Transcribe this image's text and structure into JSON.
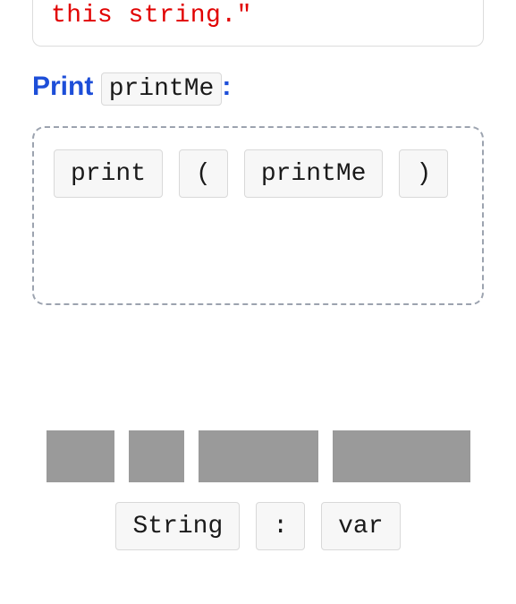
{
  "code_block": {
    "visible_string_fragment": "this string.\""
  },
  "instruction": {
    "keyword": "Print",
    "variable": "printMe",
    "suffix": ":"
  },
  "dropzone": {
    "tiles": [
      "print",
      "(",
      "printMe",
      ")"
    ]
  },
  "bank": {
    "tiles": [
      "String",
      ":",
      "var"
    ]
  }
}
